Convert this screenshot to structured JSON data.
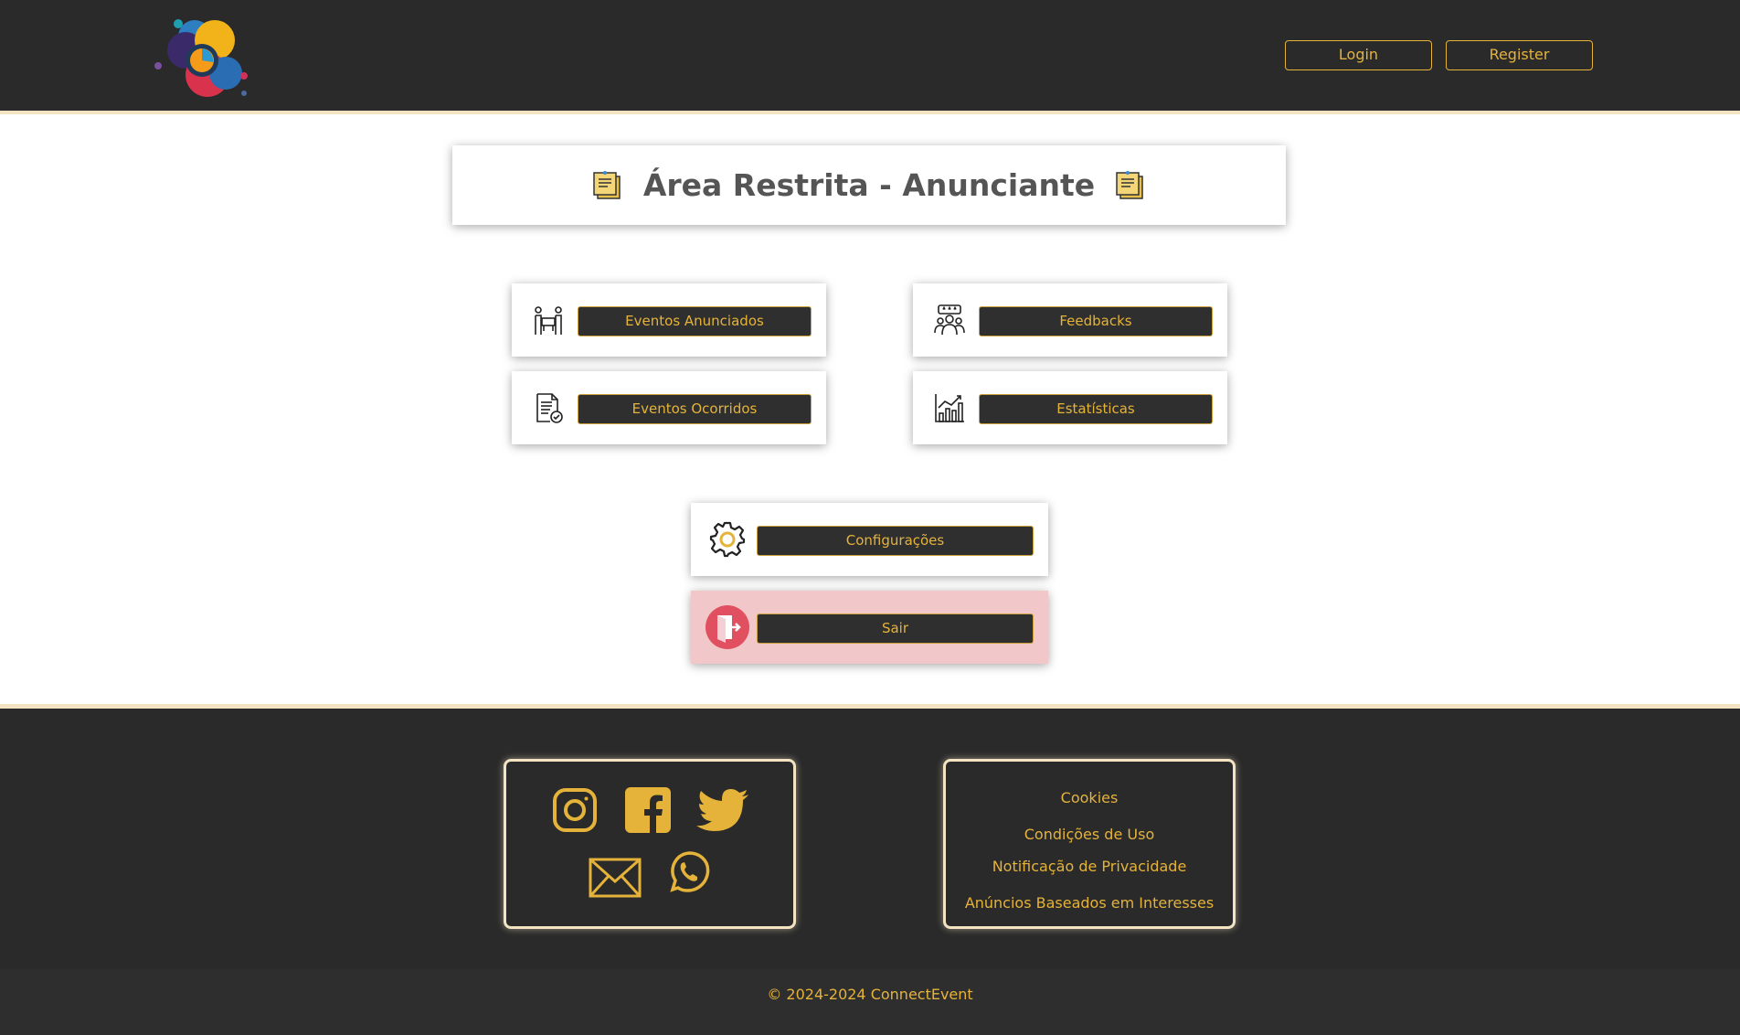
{
  "header": {
    "login_label": "Login",
    "register_label": "Register"
  },
  "page": {
    "title": "Área Restrita - Anunciante"
  },
  "menu": {
    "eventos_anunciados": "Eventos Anunciados",
    "feedbacks": "Feedbacks",
    "eventos_ocorridos": "Eventos Ocorridos",
    "estatisticas": "Estatísticas",
    "configuracoes": "Configurações",
    "sair": "Sair"
  },
  "footer": {
    "social_icons": [
      "instagram-icon",
      "facebook-icon",
      "twitter-icon",
      "mail-icon",
      "whatsapp-icon"
    ],
    "links": [
      "Cookies",
      "Condições de Uso",
      "Notificação de Privacidade",
      "Anúncios Baseados em Interesses"
    ],
    "copyright": "© 2024-2024 ConnectEvent"
  },
  "colors": {
    "dark": "#2a2a2a",
    "accent": "#e5b33a",
    "danger_bg": "#f2c7c9"
  }
}
